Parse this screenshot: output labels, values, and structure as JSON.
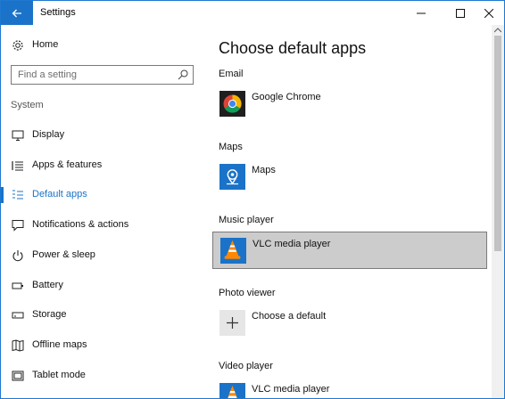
{
  "window": {
    "title": "Settings"
  },
  "sidebar": {
    "home_label": "Home",
    "search_placeholder": "Find a setting",
    "section_label": "System",
    "items": [
      {
        "label": "Display",
        "icon": "monitor-icon",
        "active": false
      },
      {
        "label": "Apps & features",
        "icon": "list-icon",
        "active": false
      },
      {
        "label": "Default apps",
        "icon": "default-apps-icon",
        "active": true
      },
      {
        "label": "Notifications & actions",
        "icon": "notification-icon",
        "active": false
      },
      {
        "label": "Power & sleep",
        "icon": "power-icon",
        "active": false
      },
      {
        "label": "Battery",
        "icon": "battery-icon",
        "active": false
      },
      {
        "label": "Storage",
        "icon": "storage-icon",
        "active": false
      },
      {
        "label": "Offline maps",
        "icon": "map-icon",
        "active": false
      },
      {
        "label": "Tablet mode",
        "icon": "tablet-icon",
        "active": false
      }
    ]
  },
  "main": {
    "title": "Choose default apps",
    "categories": [
      {
        "label": "Email",
        "app": "Google Chrome",
        "icon": "chrome-icon"
      },
      {
        "label": "Maps",
        "app": "Maps",
        "icon": "maps-app-icon"
      },
      {
        "label": "Music player",
        "app": "VLC media player",
        "icon": "vlc-icon",
        "highlighted": true
      },
      {
        "label": "Photo viewer",
        "app": "Choose a default",
        "icon": "plus-icon"
      },
      {
        "label": "Video player",
        "app": "VLC media player",
        "icon": "vlc-icon"
      }
    ]
  },
  "colors": {
    "accent": "#1a73c8",
    "highlight": "#cccccc"
  }
}
